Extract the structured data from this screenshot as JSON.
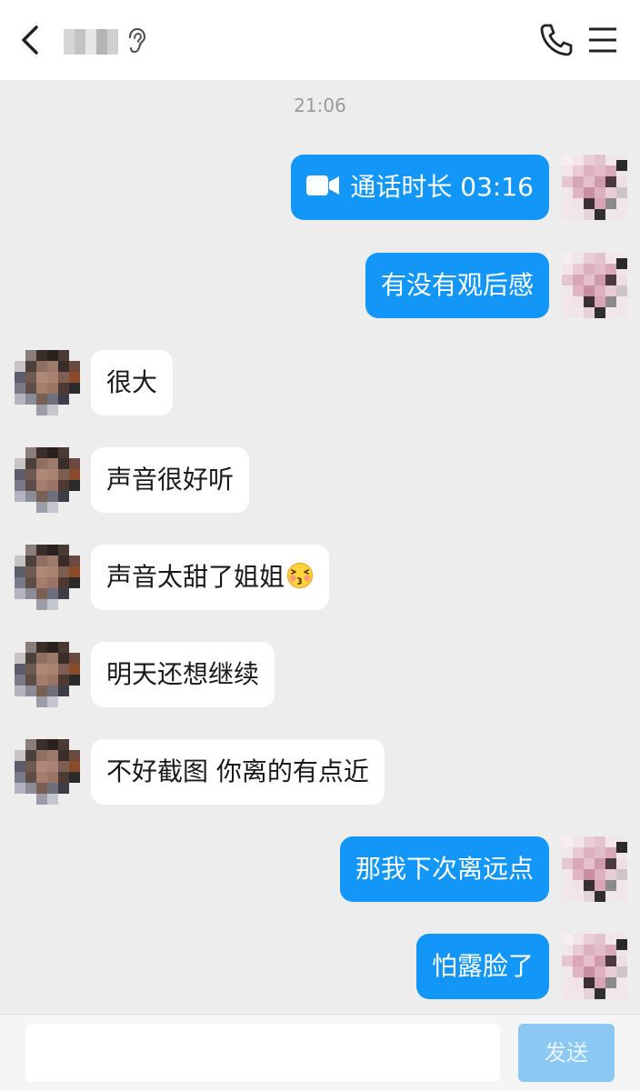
{
  "header": {
    "contact_name": "",
    "back_icon": "chevron-left-icon",
    "ear_icon": "ear-icon",
    "phone_icon": "phone-icon",
    "menu_icon": "hamburger-menu-icon"
  },
  "timestamp": "21:06",
  "colors": {
    "outgoing_bubble": "#1296f7",
    "incoming_bubble": "#ffffff",
    "background": "#ededed",
    "send_button": "#8cc8f4"
  },
  "messages": [
    {
      "direction": "out",
      "type": "call",
      "icon": "video-camera-icon",
      "text": "通话时长 03:16"
    },
    {
      "direction": "out",
      "type": "text",
      "text": "有没有观后感"
    },
    {
      "direction": "in",
      "type": "text",
      "text": "很大"
    },
    {
      "direction": "in",
      "type": "text",
      "text": "声音很好听"
    },
    {
      "direction": "in",
      "type": "text",
      "text": "声音太甜了姐姐",
      "emoji": "kissing-face-emoji"
    },
    {
      "direction": "in",
      "type": "text",
      "text": "明天还想继续"
    },
    {
      "direction": "in",
      "type": "text",
      "text": "不好截图 你离的有点近"
    },
    {
      "direction": "out",
      "type": "text",
      "text": "那我下次离远点"
    },
    {
      "direction": "out",
      "type": "text",
      "text": "怕露脸了"
    }
  ],
  "input": {
    "value": "",
    "placeholder": "",
    "send_label": "发送"
  }
}
